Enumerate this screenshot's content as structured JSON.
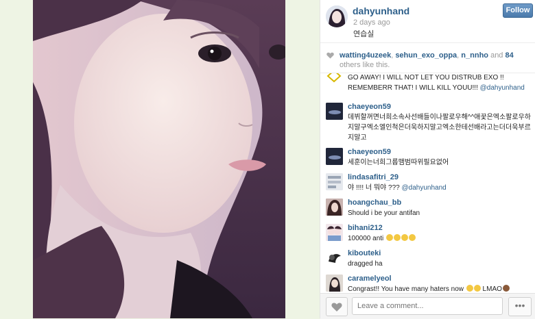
{
  "post": {
    "owner": "dahyunhand",
    "posted": "2 days ago",
    "caption": "연습실",
    "follow_label": "Follow"
  },
  "likes": {
    "users": [
      "watting4uzeek",
      "sehun_exo_oppa",
      "n_nnho"
    ],
    "sep1": ", ",
    "sep2": ", ",
    "and_text": " and ",
    "count": "84",
    "others_text": " others like this."
  },
  "comments": [
    {
      "user": "",
      "text": "GO AWAY! I WILL NOT LET YOU DISTRUB EXO !! REMEMBERR THAT! I WILL KILL YOUU!!! ",
      "mention": "@dahyunhand"
    },
    {
      "user": "chaeyeon59",
      "text": "데뷔할꺼면너희소속사선배들이나팔로우해^^애꿏은엑소팔로우하지말구엑소엘인척은더욱하지말고엑소한테선배라고는더더욱부르지말고",
      "mention": ""
    },
    {
      "user": "chaeyeon59",
      "text": "세훈이는너희그룹맴범따위필요없어",
      "mention": ""
    },
    {
      "user": "lindasafitri_29",
      "text": "야 !!!! 너 뭐야 ??? ",
      "mention": "@dahyunhand"
    },
    {
      "user": "hoangchau_bb",
      "text": "Should i be your antifan",
      "mention": ""
    },
    {
      "user": "bihani212",
      "text": "100000 anti ",
      "mention": ""
    },
    {
      "user": "kibouteki",
      "text": "dragged ha",
      "mention": ""
    },
    {
      "user": "caramelyeol",
      "text": "Congrast!! You have many haters now ",
      "text2": " LMAO",
      "mention": ""
    }
  ],
  "footer": {
    "comment_placeholder": "Leave a comment...",
    "more_label": "•••"
  },
  "icons": {
    "like": "heart-icon",
    "more": "ellipsis-icon"
  },
  "colors": {
    "link": "#2d5f8a",
    "follow_button": "#4a7aab",
    "emoji": "#f3c842"
  }
}
